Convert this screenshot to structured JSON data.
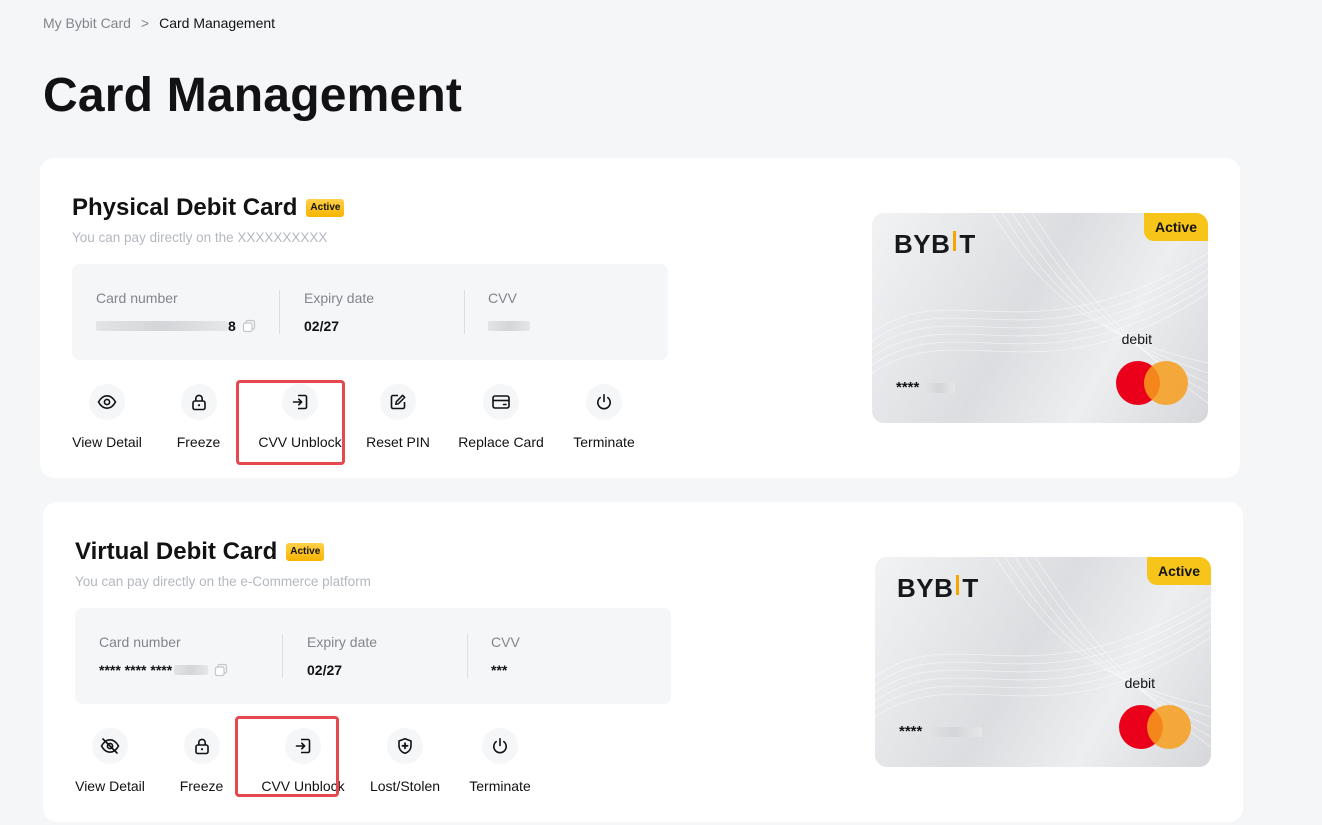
{
  "breadcrumb": {
    "parent": "My Bybit Card",
    "separator": ">",
    "current": "Card Management"
  },
  "page_title": "Card Management",
  "physical": {
    "title": "Physical Debit Card",
    "badge": "Active",
    "subtitle": "You can pay directly on the XXXXXXXXXX",
    "card_number_label": "Card number",
    "card_number_suffix": "8",
    "expiry_label": "Expiry date",
    "expiry_value": "02/27",
    "cvv_label": "CVV",
    "actions": [
      "View Detail",
      "Freeze",
      "CVV Unblock",
      "Reset PIN",
      "Replace Card",
      "Terminate"
    ],
    "card": {
      "brand": "BYBIT",
      "status": "Active",
      "type": "debit",
      "masked_number": "****"
    }
  },
  "virtual": {
    "title": "Virtual Debit Card",
    "badge": "Active",
    "subtitle": "You can pay directly on the e-Commerce platform",
    "card_number_label": "Card number",
    "card_number_value": "**** **** ****",
    "expiry_label": "Expiry date",
    "expiry_value": "02/27",
    "cvv_label": "CVV",
    "cvv_value": "***",
    "actions": [
      "View Detail",
      "Freeze",
      "CVV Unblock",
      "Lost/Stolen",
      "Terminate"
    ],
    "card": {
      "brand": "BYBIT",
      "status": "Active",
      "type": "debit",
      "masked_number": "****"
    }
  },
  "colors": {
    "accent": "#f7a600",
    "badge": "#f7c51a",
    "highlight": "#e5484d",
    "mc_red": "#eb001b",
    "mc_yellow": "#f79e1b"
  },
  "icons": {
    "view_detail": "eye-icon",
    "view_detail_hidden": "eye-off-icon",
    "freeze": "lock-icon",
    "cvv_unblock": "login-icon",
    "reset_pin": "edit-icon",
    "replace_card": "card-icon",
    "terminate": "power-icon",
    "lost_stolen": "shield-plus-icon",
    "copy": "copy-icon"
  }
}
